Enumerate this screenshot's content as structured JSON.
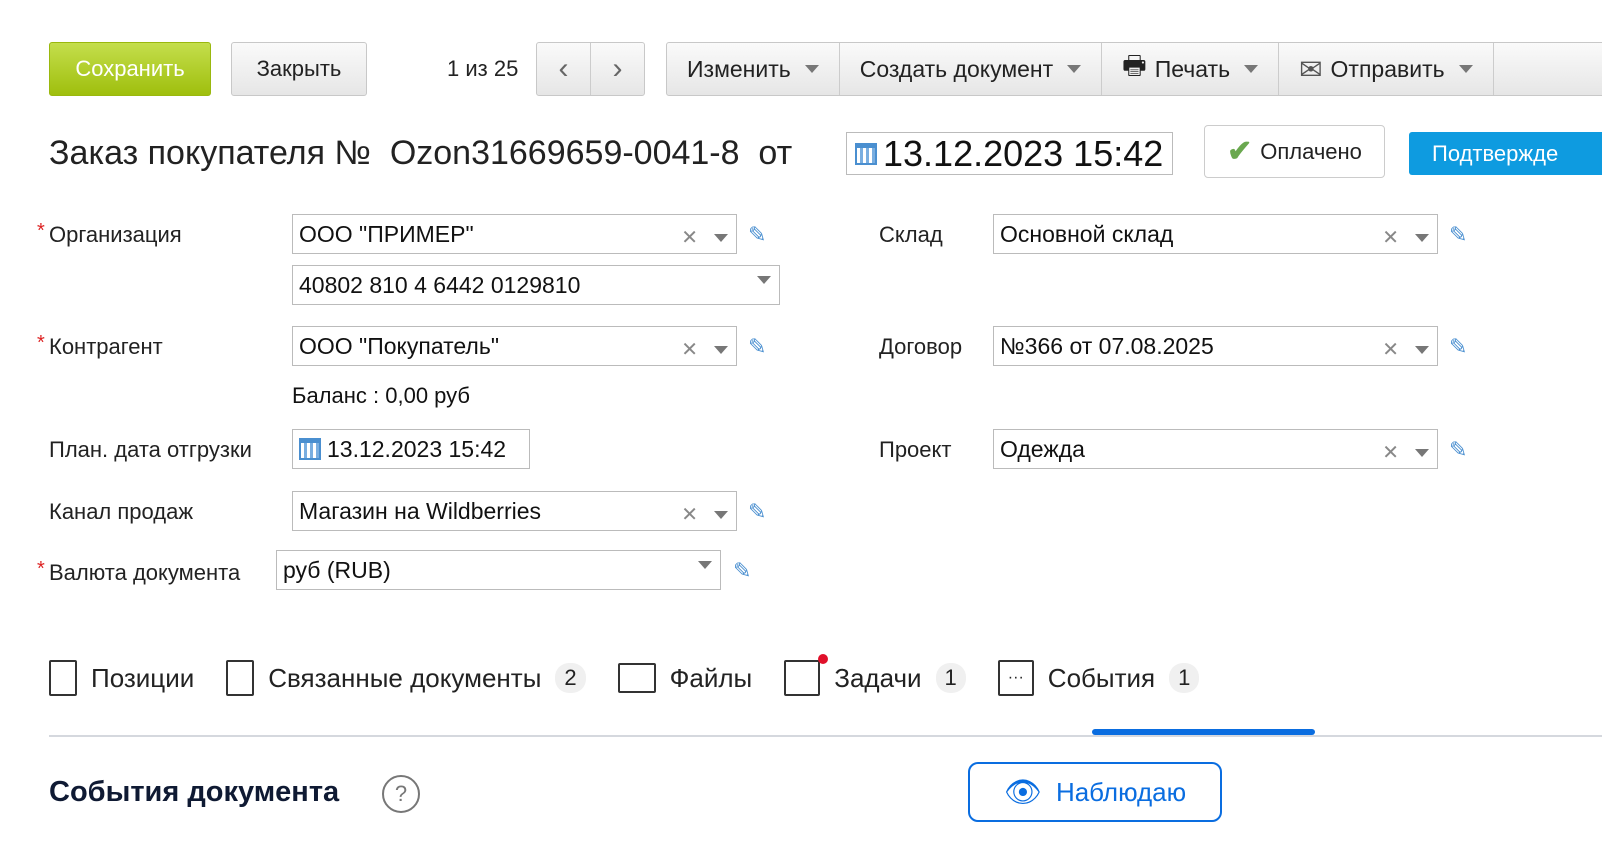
{
  "toolbar": {
    "save": "Сохранить",
    "close": "Закрыть",
    "pager": "1 из 25",
    "prev": "‹",
    "next": "›",
    "menu": [
      {
        "label": "Изменить",
        "icon": ""
      },
      {
        "label": "Создать документ",
        "icon": ""
      },
      {
        "label": "Печать",
        "icon": "printer-icon"
      },
      {
        "label": "Отправить",
        "icon": "envelope-icon"
      }
    ]
  },
  "header": {
    "title": "Заказ покупателя №  Ozon31669659-0041-8  от",
    "date": "13.12.2023 15:42",
    "status": "Оплачено",
    "confirm": "Подтвержде"
  },
  "form": {
    "org_label": "Организация",
    "org": "ООО \"ПРИМЕР\"",
    "account": "40802 810 4 6442 0129810",
    "contractor_label": "Контрагент",
    "contractor": "ООО \"Покупатель\"",
    "balance": "Баланс : 0,00 руб",
    "ship_label": "План. дата отгрузки",
    "ship": "13.12.2023 15:42",
    "channel_label": "Канал продаж",
    "channel": "Магазин на Wildberries",
    "currency_label": "Валюта документа",
    "currency": "руб (RUB)",
    "warehouse_label": "Склад",
    "warehouse": "Основной склад",
    "contract_label": "Договор",
    "contract": "№366 от 07.08.2025",
    "project_label": "Проект",
    "project": "Одежда"
  },
  "tabs": [
    {
      "label": "Позиции",
      "count": ""
    },
    {
      "label": "Связанные документы",
      "count": "2"
    },
    {
      "label": "Файлы",
      "count": ""
    },
    {
      "label": "Задачи",
      "count": "1"
    },
    {
      "label": "События",
      "count": "1",
      "active": true
    }
  ],
  "events": {
    "title": "События документа",
    "help": "?",
    "watch": "Наблюдаю"
  },
  "colors": {
    "save": "#a4c414",
    "confirm": "#0e9be0",
    "accent": "#0a6de0",
    "required": "#d22222"
  }
}
